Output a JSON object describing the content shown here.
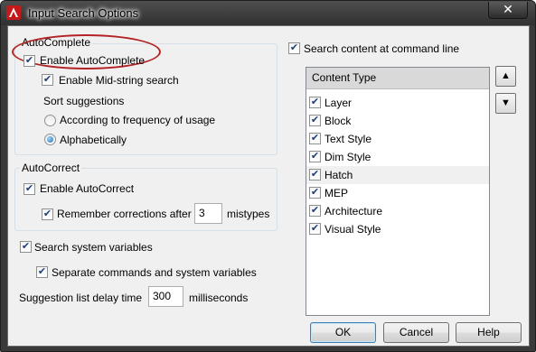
{
  "window": {
    "title": "Input Search Options",
    "close_glyph": "✕"
  },
  "autocomplete": {
    "legend": "AutoComplete",
    "enable": {
      "label": "Enable AutoComplete",
      "checked": true
    },
    "midstring": {
      "label": "Enable Mid-string search",
      "checked": true
    },
    "sort_label": "Sort suggestions",
    "sort_options": [
      {
        "label": "According to frequency of usage",
        "selected": false
      },
      {
        "label": "Alphabetically",
        "selected": true
      }
    ]
  },
  "autocorrect": {
    "legend": "AutoCorrect",
    "enable": {
      "label": "Enable AutoCorrect",
      "checked": true
    },
    "remember": {
      "label": "Remember corrections after",
      "checked": true,
      "value": "3",
      "suffix": "mistypes"
    }
  },
  "system_vars": {
    "search": {
      "label": "Search system variables",
      "checked": true
    },
    "separate": {
      "label": "Separate commands and system variables",
      "checked": true
    }
  },
  "delay": {
    "label": "Suggestion list delay time",
    "value": "300",
    "suffix": "milliseconds"
  },
  "content": {
    "search_label": "Search content at command line",
    "search_checked": true,
    "header": "Content Type",
    "items": [
      {
        "label": "Layer",
        "checked": true
      },
      {
        "label": "Block",
        "checked": true
      },
      {
        "label": "Text Style",
        "checked": true
      },
      {
        "label": "Dim Style",
        "checked": true
      },
      {
        "label": "Hatch",
        "checked": true,
        "highlighted": true
      },
      {
        "label": "MEP",
        "checked": true
      },
      {
        "label": "Architecture",
        "checked": true
      },
      {
        "label": "Visual Style",
        "checked": true
      }
    ],
    "up_glyph": "▲",
    "down_glyph": "▼"
  },
  "buttons": {
    "ok": "OK",
    "cancel": "Cancel",
    "help": "Help"
  },
  "check_glyph": "✔",
  "icons": {
    "app": "autocad-a-icon"
  }
}
